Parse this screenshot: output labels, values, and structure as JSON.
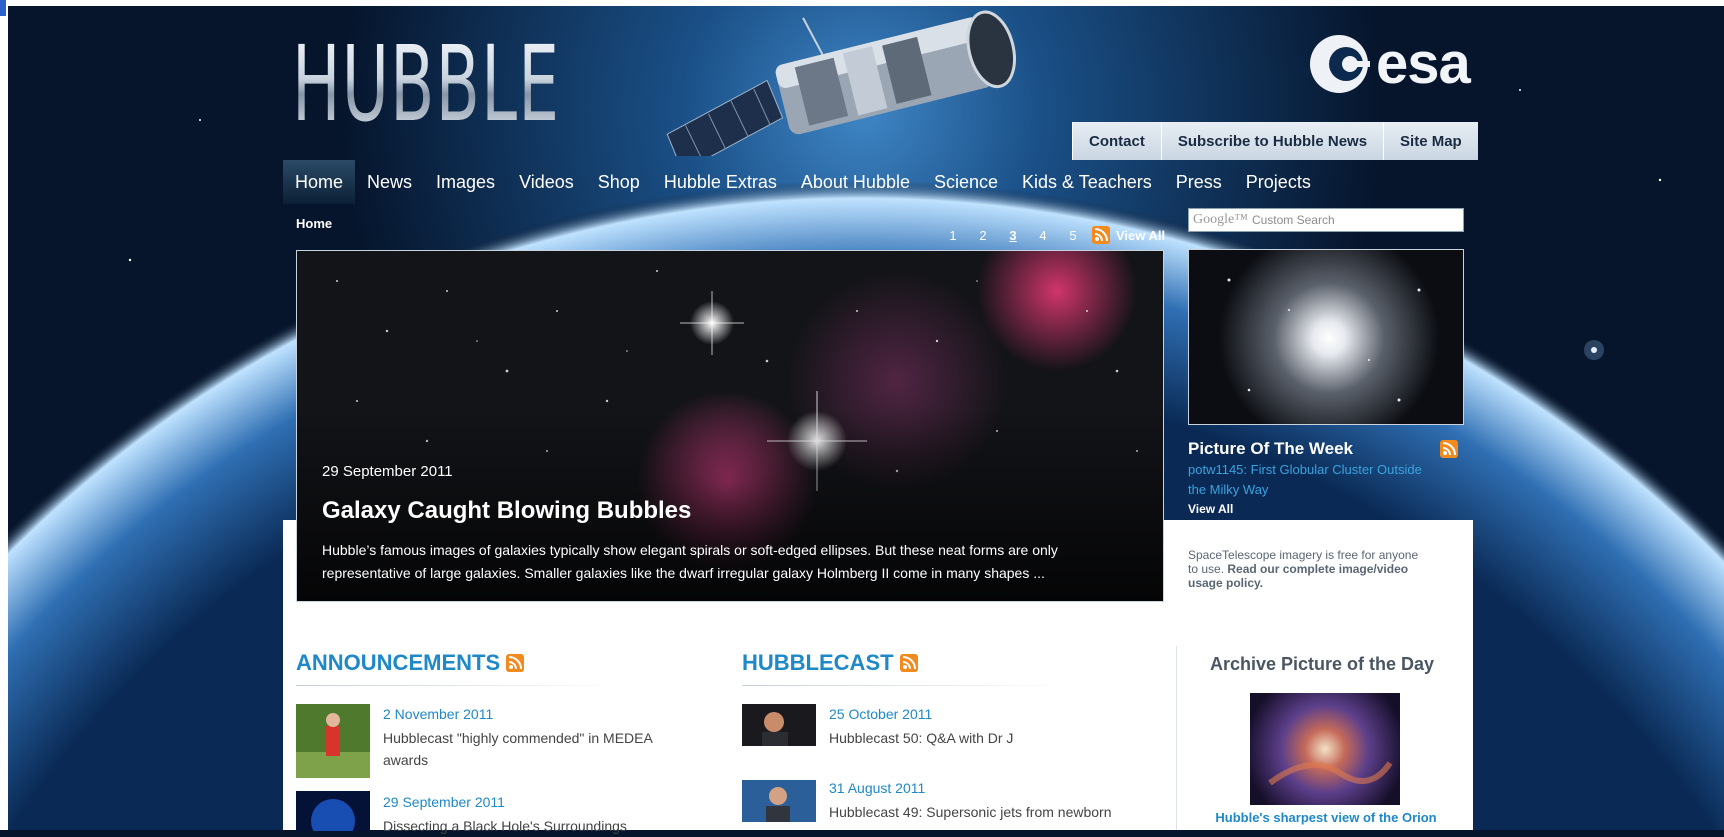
{
  "header": {
    "logo_text": "HUBBLE",
    "esa_text": "esa",
    "utility_links": [
      "Contact",
      "Subscribe to Hubble News",
      "Site Map"
    ]
  },
  "nav": {
    "items": [
      "Home",
      "News",
      "Images",
      "Videos",
      "Shop",
      "Hubble Extras",
      "About Hubble",
      "Science",
      "Kids & Teachers",
      "Press",
      "Projects"
    ],
    "active": "Home"
  },
  "breadcrumb": "Home",
  "pager": {
    "pages": [
      "1",
      "2",
      "3",
      "4",
      "5"
    ],
    "current": "3",
    "view_all": "View All"
  },
  "search": {
    "brand": "Google™",
    "placeholder": "Custom Search"
  },
  "featured": {
    "date": "29 September 2011",
    "title": "Galaxy Caught Blowing Bubbles",
    "description": "Hubble’s famous images of galaxies typically show elegant spirals or soft-edged ellipses. But these neat forms are only representative of large galaxies. Smaller galaxies like the dwarf irregular galaxy Holmberg II come in many shapes ..."
  },
  "potw": {
    "title": "Picture Of The Week",
    "link": "potw1145: First Globular Cluster Outside the Milky Way",
    "view_all": "View All"
  },
  "usage": {
    "text": "SpaceTelescope imagery is free for anyone to use.",
    "bold": "Read our complete image/video usage policy."
  },
  "announcements": {
    "title": "ANNOUNCEMENTS",
    "items": [
      {
        "date": "2 November 2011",
        "text": "Hubblecast \"highly commended\" in MEDEA awards"
      },
      {
        "date": "29 September 2011",
        "text": "Dissecting a Black Hole's Surroundings"
      }
    ]
  },
  "hubblecast": {
    "title": "HUBBLECAST",
    "items": [
      {
        "date": "25 October 2011",
        "text": "Hubblecast 50: Q&A with Dr J"
      },
      {
        "date": "31 August 2011",
        "text": "Hubblecast 49: Supersonic jets from newborn"
      }
    ]
  },
  "archive": {
    "title": "Archive Picture of the Day",
    "caption": "Hubble's sharpest view of the Orion"
  },
  "colors": {
    "accent": "#1f88c7",
    "rss": "#f28a1e",
    "page_bg": "#06152c"
  }
}
